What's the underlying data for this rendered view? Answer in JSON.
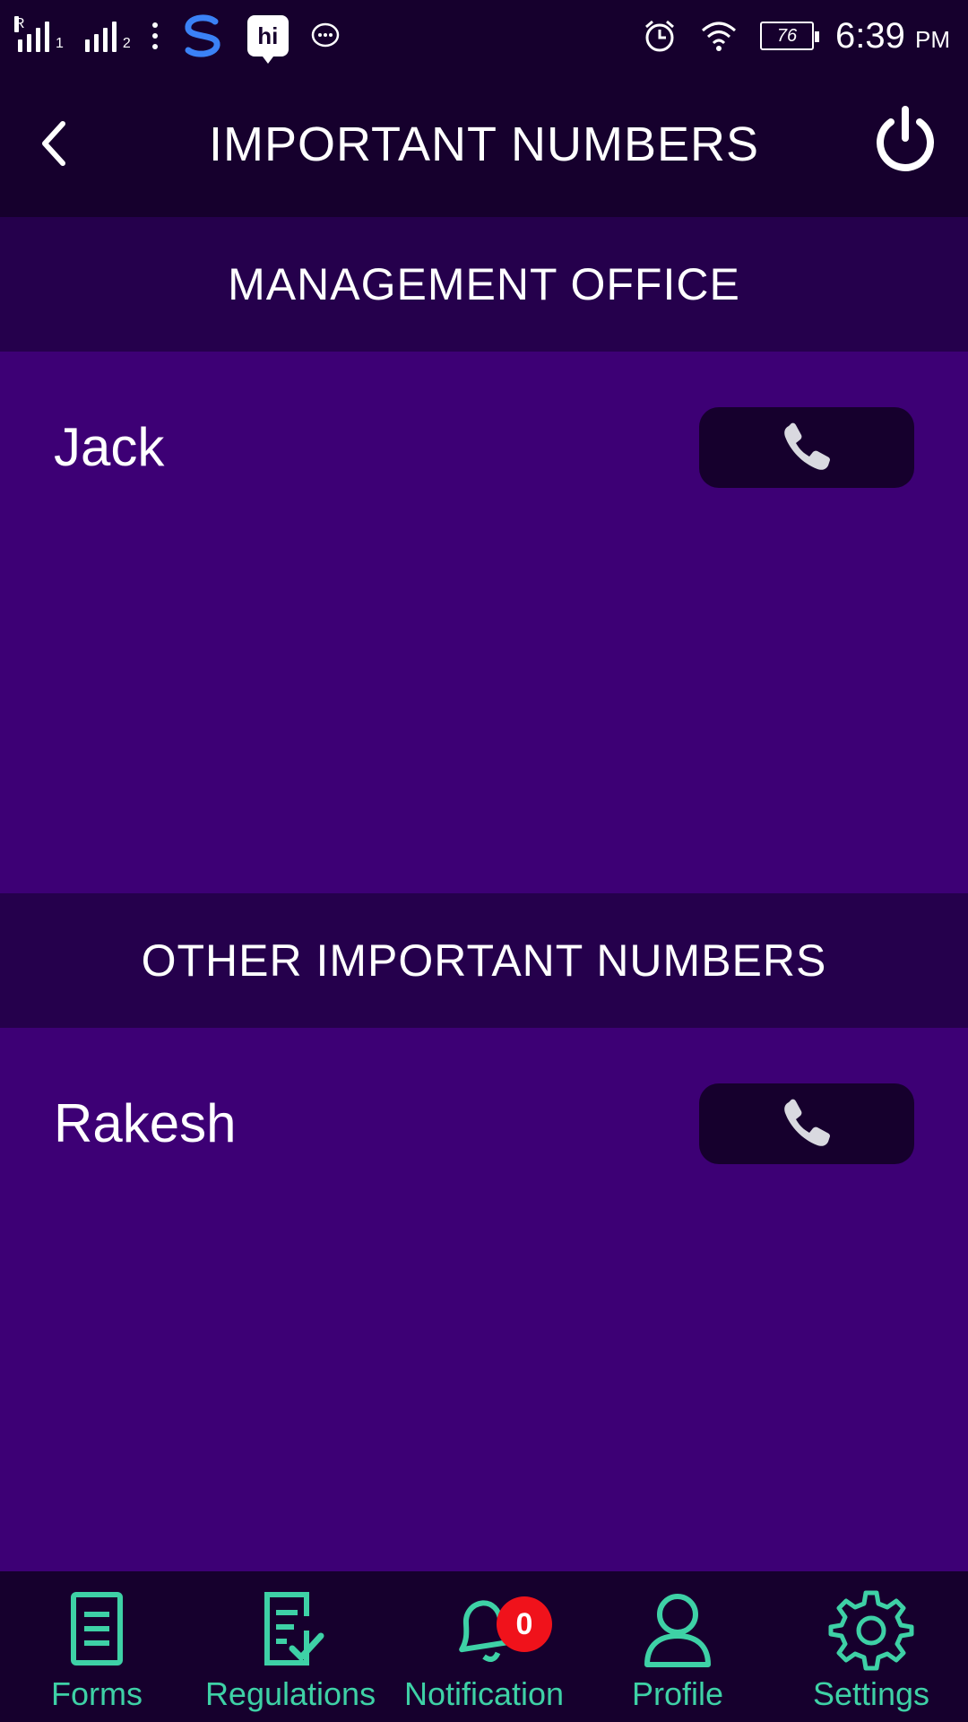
{
  "status_bar": {
    "roaming_indicator": "R",
    "sim1": "1",
    "sim2": "2",
    "hi_app_label": "hi",
    "battery": "76",
    "time": "6:39",
    "ampm": "PM"
  },
  "header": {
    "title": "IMPORTANT NUMBERS"
  },
  "sections": [
    {
      "title": "MANAGEMENT OFFICE",
      "contacts": [
        {
          "name": "Jack"
        }
      ]
    },
    {
      "title": "OTHER IMPORTANT NUMBERS",
      "contacts": [
        {
          "name": "Rakesh"
        }
      ]
    }
  ],
  "bottom_nav": {
    "items": [
      {
        "label": "Forms",
        "icon": "document-icon"
      },
      {
        "label": "Regulations",
        "icon": "checklist-icon"
      },
      {
        "label": "Notification",
        "icon": "bell-icon",
        "badge": "0"
      },
      {
        "label": "Profile",
        "icon": "person-icon"
      },
      {
        "label": "Settings",
        "icon": "gear-icon"
      }
    ]
  },
  "colors": {
    "bar_bg": "#16002d",
    "section_header_bg": "#25004c",
    "content_bg": "#3d0075",
    "nav_accent": "#3ed1a6",
    "badge_red": "#f0121b"
  }
}
